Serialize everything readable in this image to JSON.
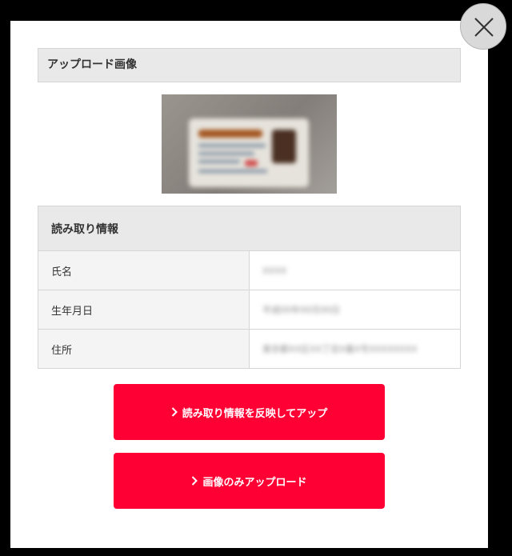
{
  "upload_section": {
    "title": "アップロード画像"
  },
  "read_info": {
    "title": "読み取り情報",
    "rows": [
      {
        "label": "氏名",
        "value": "XXXX"
      },
      {
        "label": "生年月日",
        "value": "平成00年00月00日"
      },
      {
        "label": "住所",
        "value": "東京都XX区XX丁目X番X号XXXXXXXX"
      }
    ]
  },
  "buttons": {
    "apply_and_upload": "読み取り情報を反映してアップ",
    "image_only_upload": "画像のみアップロード"
  },
  "colors": {
    "accent": "#ff0035",
    "header_bg": "#e9e9e9",
    "label_bg": "#f4f4f4"
  },
  "icons": {
    "close": "close-icon",
    "chevron": "chevron-right-icon"
  }
}
